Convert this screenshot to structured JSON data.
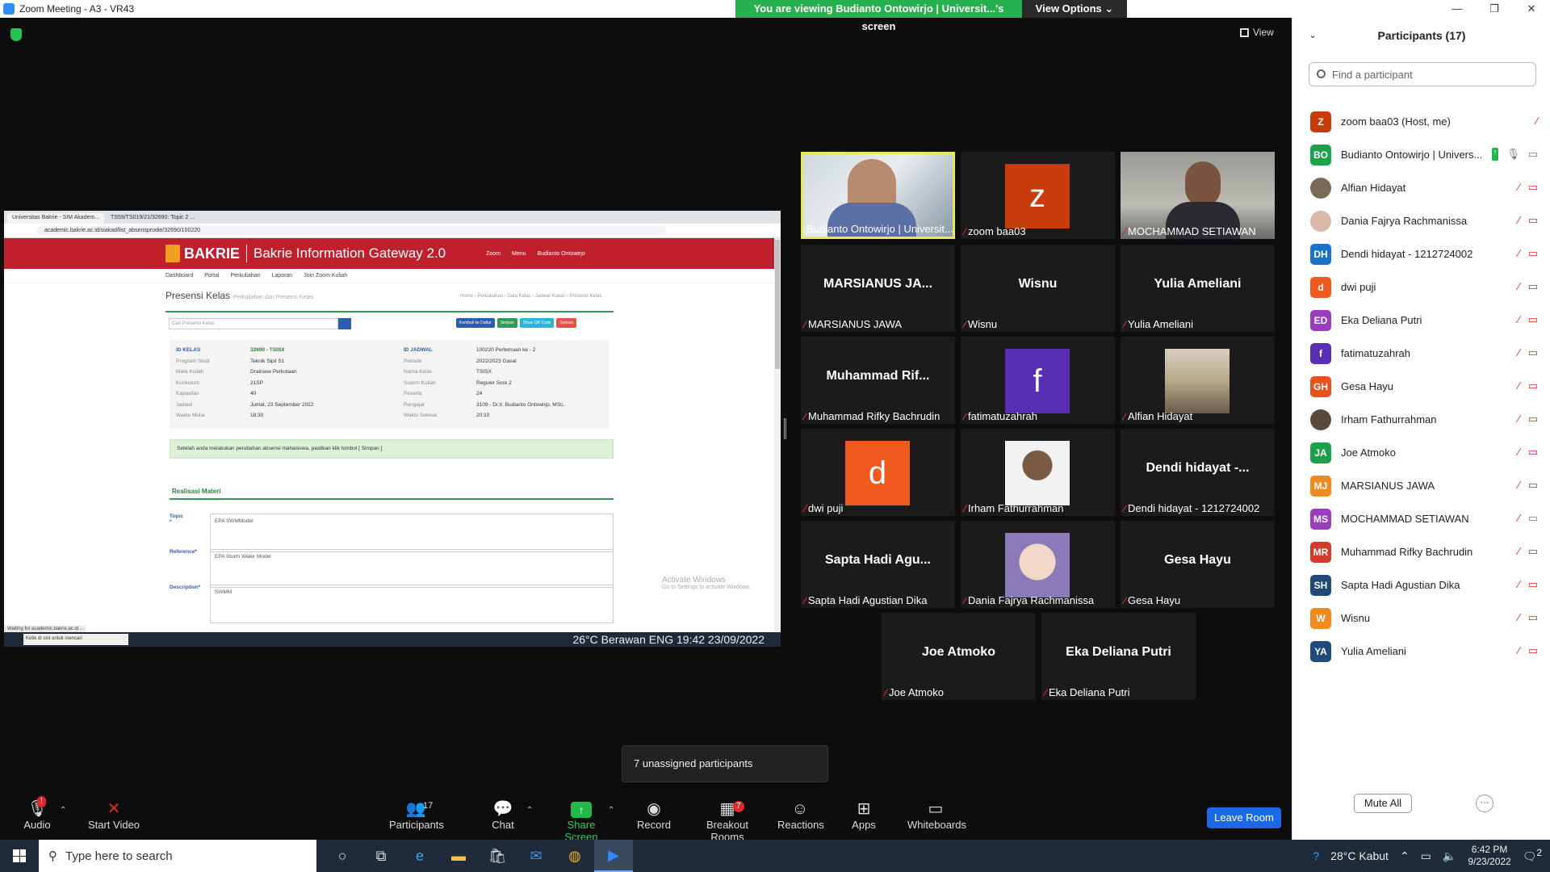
{
  "window": {
    "title": "Zoom Meeting - A3 - VR43",
    "minimize": "—",
    "restore": "❐",
    "close": "✕"
  },
  "banner": {
    "text": "You are viewing Budianto Ontowirjo | Universit...'s screen",
    "view_options": "View Options"
  },
  "view_button": "View",
  "shared_screen": {
    "tab1": "Universitas Bakrie - SIM Akadem...",
    "tab2": "TS59/TS019/21/32690: Topic 2 ...",
    "url": "academic.bakrie.ac.id/siakad/list_absensprodie/32690/100220",
    "brand": "BAKRIE",
    "gateway": "Bakrie Information Gateway 2.0",
    "hdr_zoom": "Zoom",
    "hdr_menu": "Menu",
    "hdr_user": "Budianto Ontowirjo",
    "nav": [
      "Dashboard",
      "Portal",
      "Perkuliahan",
      "Laporan",
      "Join Zoom Kuliah"
    ],
    "page_title": "Presensi Kelas",
    "page_sub": "Perkuliahan dan Presensi Kelas",
    "breadcrumb": "Home › Perkuliahan › Data Kelas › Jadwal Kuliah › Presensi Kelas",
    "search_placeholder": "Cari Presensi Kelas",
    "btn_back": "Kembali ke Daftar",
    "btn_save": "Simpan",
    "btn_qr": "Show QR Code",
    "btn_done": "Selesai",
    "left_labels": [
      "ID KELAS",
      "Program Studi",
      "Mata Kuliah",
      "Kurikulum",
      "Kapasitas",
      "Jadwal",
      "Waktu Mulai"
    ],
    "left_values": [
      "32690 - TSISX",
      "Teknik Sipil S1",
      "Drainase Perkotaan",
      "21SP",
      "40",
      "Jumat, 23 September 2022",
      "18:30"
    ],
    "right_labels": [
      "ID JADWAL",
      "Periode",
      "Nama Kelas",
      "Sistem Kuliah",
      "Peserta",
      "Pengajar",
      "Waktu Selesai"
    ],
    "right_values": [
      "100220 Pertemuan ke - 2",
      "2022/2023 Gasal",
      "TSISX",
      "Reguler Sore 2",
      "24",
      "3109 - Dr.Ir. Budianto Ontowirjo, MSc.",
      "20:10"
    ],
    "alert": "Setelah anda melakukan perubahan absensi mahasiswa, pastikan klik tombol [ Simpan ]",
    "section": "Realisasi Materi",
    "topic_label": "Topic *",
    "topic_value": "EPA SWMModel",
    "reference_label": "Reference*",
    "reference_value": "EPA Storm Water Model",
    "description_label": "Description*",
    "description_value": "SWMM",
    "activate_title": "Activate Windows",
    "activate_sub": "Go to Settings to activate Windows.",
    "status": "Waiting for academic.bakrie.ac.id...",
    "taskbar_search": "Ketik di sini untuk mencari",
    "taskbar_tray": "26°C Berawan  ENG  19:42 23/09/2022"
  },
  "tiles": [
    {
      "label": "Budianto Ontowirjo | Universit...",
      "type": "video",
      "muted": false
    },
    {
      "label": "zoom baa03",
      "avatar": "z",
      "color": "#c83c0c",
      "muted": true
    },
    {
      "label": "MOCHAMMAD SETIAWAN",
      "type": "video2",
      "muted": true
    },
    {
      "label": "MARSIANUS JAWA",
      "big": "MARSIANUS JA...",
      "muted": true
    },
    {
      "label": "Wisnu",
      "big": "Wisnu",
      "muted": true
    },
    {
      "label": "Yulia Ameliani",
      "big": "Yulia Ameliani",
      "muted": true
    },
    {
      "label": "Muhammad Rifky Bachrudin",
      "big": "Muhammad Rif...",
      "muted": true
    },
    {
      "label": "fatimatuzahrah",
      "avatar": "f",
      "color": "#5a2db5",
      "muted": true
    },
    {
      "label": "Alfian Hidayat",
      "photo": "landscape",
      "muted": true
    },
    {
      "label": "dwi puji",
      "avatar": "d",
      "color": "#f05a1e",
      "muted": true
    },
    {
      "label": "Irham Fathurrahman",
      "photo": "person",
      "muted": true
    },
    {
      "label": "Dendi hidayat - 1212724002",
      "big": "Dendi hidayat -...",
      "muted": true
    },
    {
      "label": "Sapta Hadi Agustian Dika",
      "big": "Sapta Hadi Agu...",
      "muted": true
    },
    {
      "label": "Dania Fajrya Rachmanissa",
      "photo": "anime",
      "muted": true
    },
    {
      "label": "Gesa Hayu",
      "big": "Gesa Hayu",
      "muted": true
    },
    {
      "label": "Joe Atmoko",
      "big": "Joe Atmoko",
      "muted": true
    },
    {
      "label": "Eka Deliana Putri",
      "big": "Eka Deliana Putri",
      "muted": true
    }
  ],
  "panel": {
    "title": "Participants (17)",
    "search_placeholder": "Find a participant",
    "participants": [
      {
        "initials": "Z",
        "color": "#c83c0c",
        "name": "zoom baa03 (Host, me)",
        "mic": "off",
        "video": "none"
      },
      {
        "initials": "BO",
        "color": "#1ca04a",
        "name": "Budianto Ontowirjo | Univers...",
        "mic": "on",
        "video": "on",
        "sharing": true
      },
      {
        "initials": "",
        "color": "#7a6a55",
        "name": "Alfian Hidayat",
        "mic": "off",
        "video": "off"
      },
      {
        "initials": "",
        "color": "#d9b8a8",
        "name": "Dania Fajrya Rachmanissa",
        "mic": "off",
        "video": "off"
      },
      {
        "initials": "DH",
        "color": "#1a73c8",
        "name": "Dendi hidayat - 1212724002",
        "mic": "off",
        "video": "off"
      },
      {
        "initials": "d",
        "color": "#f05a1e",
        "name": "dwi puji",
        "mic": "off",
        "video": "off"
      },
      {
        "initials": "ED",
        "color": "#9b3dbf",
        "name": "Eka Deliana Putri",
        "mic": "off",
        "video": "off"
      },
      {
        "initials": "f",
        "color": "#5a2db5",
        "name": "fatimatuzahrah",
        "mic": "off",
        "video": "off"
      },
      {
        "initials": "GH",
        "color": "#e8501e",
        "name": "Gesa Hayu",
        "mic": "off",
        "video": "off"
      },
      {
        "initials": "",
        "color": "#5a4a3e",
        "name": "Irham Fathurrahman",
        "mic": "off",
        "video": "off"
      },
      {
        "initials": "JA",
        "color": "#1ca04a",
        "name": "Joe Atmoko",
        "mic": "off",
        "video": "off"
      },
      {
        "initials": "MJ",
        "color": "#f08a1e",
        "name": "MARSIANUS JAWA",
        "mic": "off",
        "video": "off"
      },
      {
        "initials": "MS",
        "color": "#9b3dbf",
        "name": "MOCHAMMAD SETIAWAN",
        "mic": "off",
        "video": "on"
      },
      {
        "initials": "MR",
        "color": "#d23a2a",
        "name": "Muhammad Rifky Bachrudin",
        "mic": "off",
        "video": "off"
      },
      {
        "initials": "SH",
        "color": "#1f4a7a",
        "name": "Sapta Hadi Agustian Dika",
        "mic": "off",
        "video": "off"
      },
      {
        "initials": "W",
        "color": "#f08a1e",
        "name": "Wisnu",
        "mic": "off",
        "video": "off"
      },
      {
        "initials": "YA",
        "color": "#1f4a7a",
        "name": "Yulia Ameliani",
        "mic": "off",
        "video": "off"
      }
    ],
    "mute_all": "Mute All",
    "more": "···"
  },
  "toolbar": {
    "audio": "Audio",
    "audio_badge": "!",
    "start_video": "Start Video",
    "participants": "Participants",
    "participants_count": "17",
    "chat": "Chat",
    "share": "Share Screen",
    "record": "Record",
    "breakout": "Breakout Rooms",
    "breakout_badge": "7",
    "reactions": "Reactions",
    "apps": "Apps",
    "whiteboards": "Whiteboards",
    "leave": "Leave Room",
    "tooltip": "7 unassigned participants"
  },
  "taskbar": {
    "search_placeholder": "Type here to search",
    "weather": "28°C  Kabut",
    "time": "6:42 PM",
    "date": "9/23/2022",
    "notif": "2"
  }
}
